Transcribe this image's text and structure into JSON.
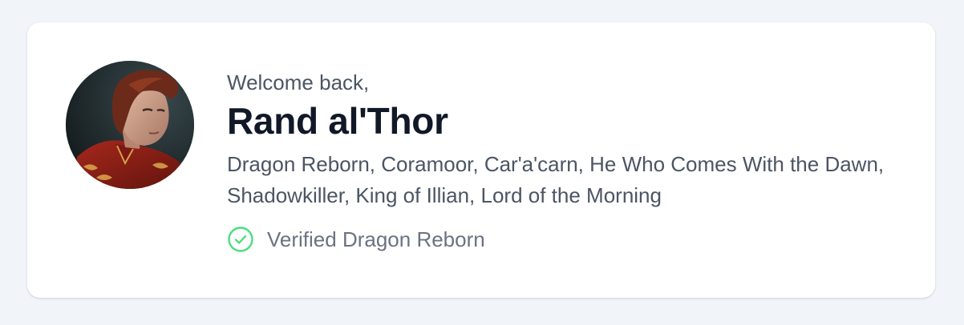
{
  "greeting": "Welcome back,",
  "user": {
    "name": "Rand al'Thor",
    "titles": "Dragon Reborn, Coramoor, Car'a'carn, He Who Comes With the Dawn, Shadowkiller, King of Illian, Lord of the Morning",
    "avatar_icon": "user-portrait-avatar"
  },
  "verification": {
    "label": "Verified Dragon Reborn",
    "icon": "check-circle-icon",
    "color": "#4ade80"
  },
  "colors": {
    "background": "#f1f4f9",
    "card": "#ffffff",
    "name": "#111827",
    "text": "#4b5563",
    "muted": "#6b7280"
  }
}
